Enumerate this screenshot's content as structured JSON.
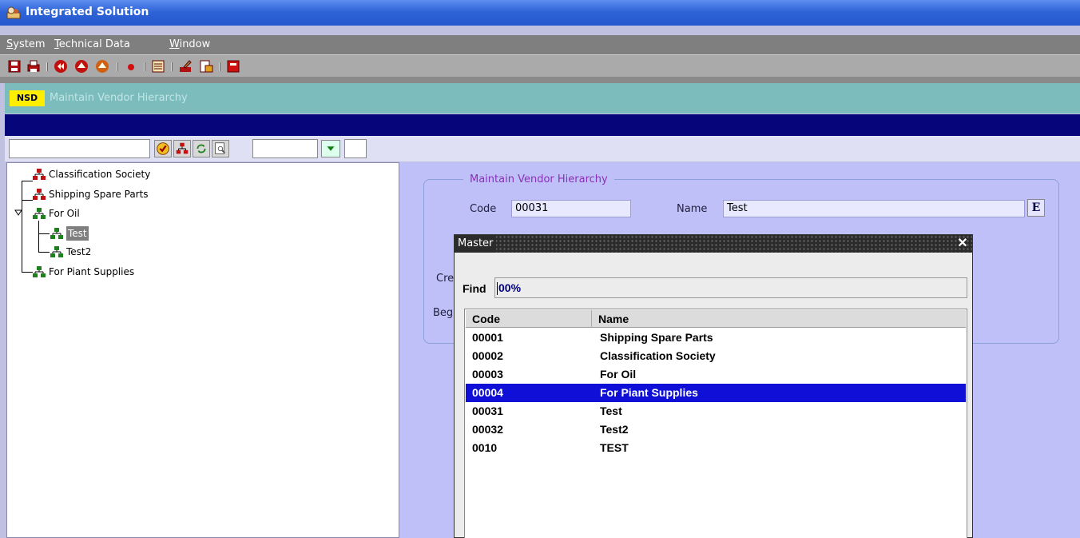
{
  "window": {
    "title": "Integrated Solution"
  },
  "menubar": {
    "items": [
      {
        "label": "System",
        "underline": "S",
        "rest": "ystem"
      },
      {
        "label": "Technical Data",
        "underline": "T",
        "rest": "echnical Data"
      },
      {
        "label": "Window",
        "underline": "W",
        "rest": "indow"
      }
    ]
  },
  "toolbar": {
    "icons": [
      "save-icon",
      "print-icon",
      "first-record-icon",
      "previous-record-icon",
      "next-record-icon",
      "record-icon",
      "list-icon",
      "edit-icon",
      "export-icon",
      "exit-icon"
    ]
  },
  "module": {
    "logo": "NSD",
    "title": "Maintain Vendor Hierarchy"
  },
  "tree": {
    "items": [
      {
        "label": "Classification Society",
        "level": 0
      },
      {
        "label": "Shipping Spare Parts",
        "level": 0
      },
      {
        "label": "For Oil",
        "level": 0,
        "expanded": true
      },
      {
        "label": "Test",
        "level": 1,
        "selected": true
      },
      {
        "label": "Test2",
        "level": 1
      },
      {
        "label": "For Piant Supplies",
        "level": 0
      }
    ]
  },
  "form": {
    "group_title": "Maintain Vendor Hierarchy",
    "code_label": "Code",
    "code_value": "00031",
    "name_label": "Name",
    "name_value": "Test",
    "e_button": "E",
    "created_label_partial": "Cre",
    "begin_label_partial": "Beg"
  },
  "dialog": {
    "title": "Master",
    "close": "✕",
    "find_label": "Find",
    "find_value": "00%",
    "columns": [
      "Code",
      "Name"
    ],
    "rows": [
      {
        "code": "00001",
        "name": "Shipping Spare Parts"
      },
      {
        "code": "00002",
        "name": "Classification Society"
      },
      {
        "code": "00003",
        "name": "For Oil"
      },
      {
        "code": "00004",
        "name": "For Piant Supplies",
        "selected": true
      },
      {
        "code": "00031",
        "name": "Test"
      },
      {
        "code": "00032",
        "name": "Test2"
      },
      {
        "code": "0010",
        "name": "TEST"
      }
    ]
  },
  "colors": {
    "title_bar": "#2f64d8",
    "module_header": "#7dbcbc",
    "selection": "#0f0fd8",
    "form_bg": "#c0c0f8"
  }
}
